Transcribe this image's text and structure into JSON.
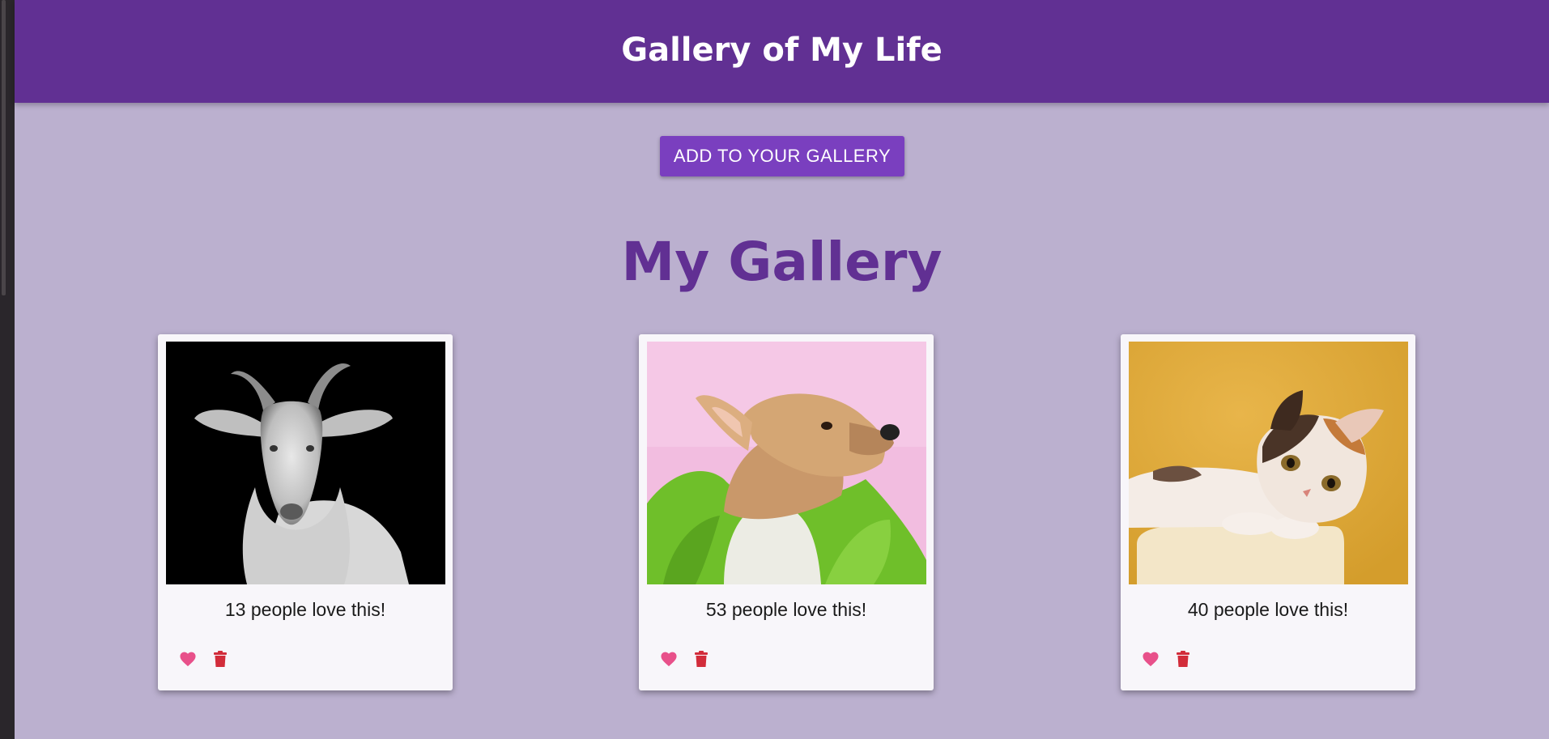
{
  "header": {
    "title": "Gallery of My Life"
  },
  "actions": {
    "add_label": "ADD TO YOUR GALLERY"
  },
  "gallery": {
    "title": "My Gallery",
    "cards": [
      {
        "subject": "goat",
        "love_text": "13 people love this!",
        "likes": 13
      },
      {
        "subject": "dog",
        "love_text": "53 people love this!",
        "likes": 53
      },
      {
        "subject": "kitten",
        "love_text": "40 people love this!",
        "likes": 40
      }
    ]
  },
  "icons": {
    "like": "heart-icon",
    "delete": "trash-icon"
  },
  "colors": {
    "header_bg": "#613093",
    "page_bg": "#bbb0cf",
    "button_bg": "#7a3fbf",
    "heart": "#e8508a",
    "trash": "#d22c3a"
  }
}
